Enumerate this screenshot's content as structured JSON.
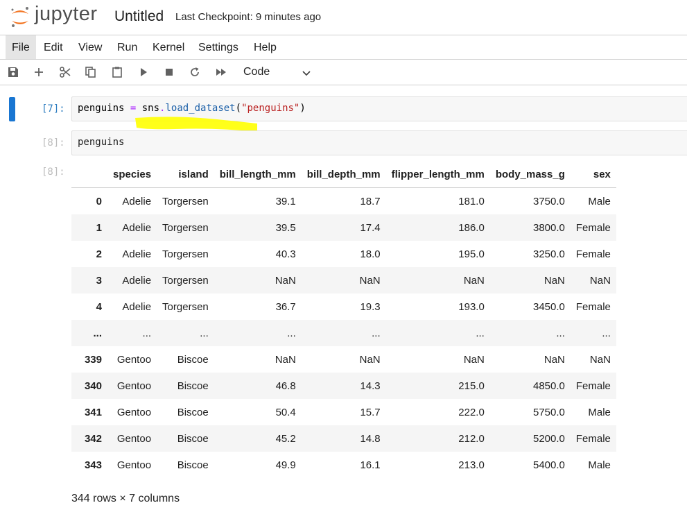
{
  "app": {
    "logo_text": "jupyter",
    "notebook_title": "Untitled",
    "checkpoint": "Last Checkpoint: 9 minutes ago"
  },
  "menu": [
    "File",
    "Edit",
    "View",
    "Run",
    "Kernel",
    "Settings",
    "Help"
  ],
  "toolbar": {
    "icons": [
      "save-icon",
      "add-icon",
      "cut-icon",
      "copy-icon",
      "paste-icon",
      "run-icon",
      "stop-icon",
      "restart-icon",
      "fast-forward-icon"
    ],
    "cell_type": "Code"
  },
  "cells": [
    {
      "prompt": "[7]:",
      "code_var": "penguins",
      "code_op": " = ",
      "code_obj": "sns",
      "code_dot": ".",
      "code_fn": "load_dataset",
      "code_open": "(",
      "code_str": "\"penguins\"",
      "code_close": ")"
    },
    {
      "prompt": "[8]:",
      "code": "penguins"
    }
  ],
  "output": {
    "prompt": "[8]:",
    "columns": [
      "species",
      "island",
      "bill_length_mm",
      "bill_depth_mm",
      "flipper_length_mm",
      "body_mass_g",
      "sex"
    ],
    "rows": [
      {
        "index": "0",
        "cells": [
          "Adelie",
          "Torgersen",
          "39.1",
          "18.7",
          "181.0",
          "3750.0",
          "Male"
        ]
      },
      {
        "index": "1",
        "cells": [
          "Adelie",
          "Torgersen",
          "39.5",
          "17.4",
          "186.0",
          "3800.0",
          "Female"
        ]
      },
      {
        "index": "2",
        "cells": [
          "Adelie",
          "Torgersen",
          "40.3",
          "18.0",
          "195.0",
          "3250.0",
          "Female"
        ]
      },
      {
        "index": "3",
        "cells": [
          "Adelie",
          "Torgersen",
          "NaN",
          "NaN",
          "NaN",
          "NaN",
          "NaN"
        ]
      },
      {
        "index": "4",
        "cells": [
          "Adelie",
          "Torgersen",
          "36.7",
          "19.3",
          "193.0",
          "3450.0",
          "Female"
        ]
      },
      {
        "index": "...",
        "cells": [
          "...",
          "...",
          "...",
          "...",
          "...",
          "...",
          "..."
        ]
      },
      {
        "index": "339",
        "cells": [
          "Gentoo",
          "Biscoe",
          "NaN",
          "NaN",
          "NaN",
          "NaN",
          "NaN"
        ]
      },
      {
        "index": "340",
        "cells": [
          "Gentoo",
          "Biscoe",
          "46.8",
          "14.3",
          "215.0",
          "4850.0",
          "Female"
        ]
      },
      {
        "index": "341",
        "cells": [
          "Gentoo",
          "Biscoe",
          "50.4",
          "15.7",
          "222.0",
          "5750.0",
          "Male"
        ]
      },
      {
        "index": "342",
        "cells": [
          "Gentoo",
          "Biscoe",
          "45.2",
          "14.8",
          "212.0",
          "5200.0",
          "Female"
        ]
      },
      {
        "index": "343",
        "cells": [
          "Gentoo",
          "Biscoe",
          "49.9",
          "16.1",
          "213.0",
          "5400.0",
          "Male"
        ]
      }
    ],
    "shape": "344 rows × 7 columns"
  },
  "colors": {
    "accent": "#1976d2",
    "highlight": "#ffff00",
    "logo_orange": "#f37726"
  }
}
